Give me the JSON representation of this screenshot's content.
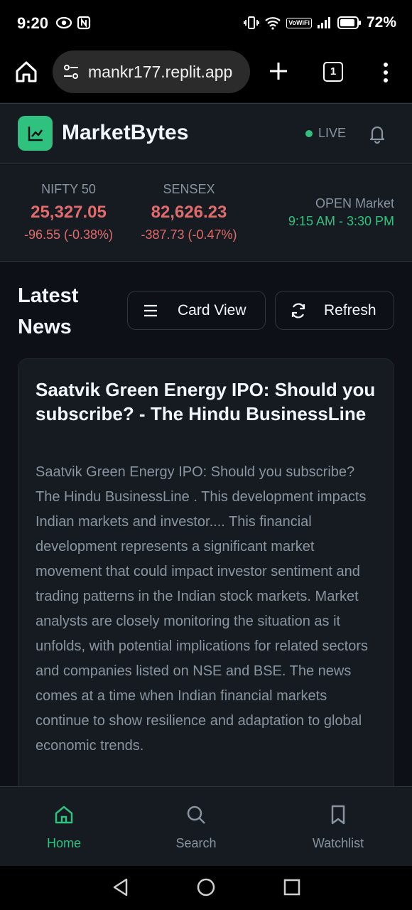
{
  "status_bar": {
    "time": "9:20",
    "battery": "72%",
    "network_tag": "VoWiFi",
    "icons": [
      "eye-icon",
      "nfc-icon",
      "vibrate-icon",
      "wifi-icon",
      "signal-icon",
      "battery-icon"
    ]
  },
  "browser": {
    "url": "mankr177.replit.app",
    "tab_count": "1",
    "icons": [
      "home-icon",
      "site-settings-icon",
      "new-tab-icon",
      "menu-icon"
    ]
  },
  "header": {
    "brand": "MarketBytes",
    "live_label": "LIVE",
    "accent_color": "#2ec27e"
  },
  "ticker": {
    "indices": [
      {
        "name": "NIFTY 50",
        "value": "25,327.05",
        "change": "-96.55 (-0.38%)"
      },
      {
        "name": "SENSEX",
        "value": "82,626.23",
        "change": "-387.73 (-0.47%)"
      }
    ],
    "market_state": "OPEN Market",
    "market_hours": "9:15 AM - 3:30 PM",
    "negative_color": "#e06c6c"
  },
  "news": {
    "title": "Latest News",
    "card_view_label": "Card View",
    "refresh_label": "Refresh",
    "articles": [
      {
        "title": "Saatvik Green Energy IPO: Should you subscribe? - The Hindu BusinessLine",
        "summary": "Saatvik Green Energy IPO: Should you subscribe? The Hindu BusinessLine . This development impacts Indian markets and investor.... This financial development represents a significant market movement that could impact investor sentiment and trading patterns in the Indian stock markets. Market analysts are closely monitoring the situation as it unfolds, with potential implications for related sectors and companies listed on NSE and BSE. The news comes at a time when Indian financial markets continue to show resilience and adaptation to global economic trends."
      }
    ]
  },
  "bottom_nav": {
    "items": [
      {
        "label": "Home",
        "icon": "home-icon",
        "active": true
      },
      {
        "label": "Search",
        "icon": "search-icon",
        "active": false
      },
      {
        "label": "Watchlist",
        "icon": "bookmark-icon",
        "active": false
      }
    ]
  }
}
